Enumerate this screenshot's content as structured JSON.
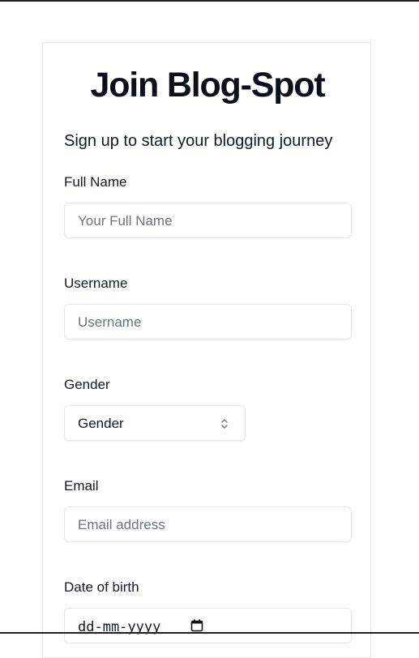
{
  "header": {
    "title": "Join Blog-Spot",
    "subtitle": "Sign up to start your blogging journey"
  },
  "form": {
    "full_name": {
      "label": "Full Name",
      "placeholder": "Your Full Name"
    },
    "username": {
      "label": "Username",
      "placeholder": "Username"
    },
    "gender": {
      "label": "Gender",
      "selected": "Gender"
    },
    "email": {
      "label": "Email",
      "placeholder": "Email address"
    },
    "dob": {
      "label": "Date of birth",
      "placeholder": "dd-mm-yyyy"
    }
  },
  "icons": {
    "select_chevron": "chevron-up-down-icon",
    "date_picker": "calendar-icon"
  }
}
